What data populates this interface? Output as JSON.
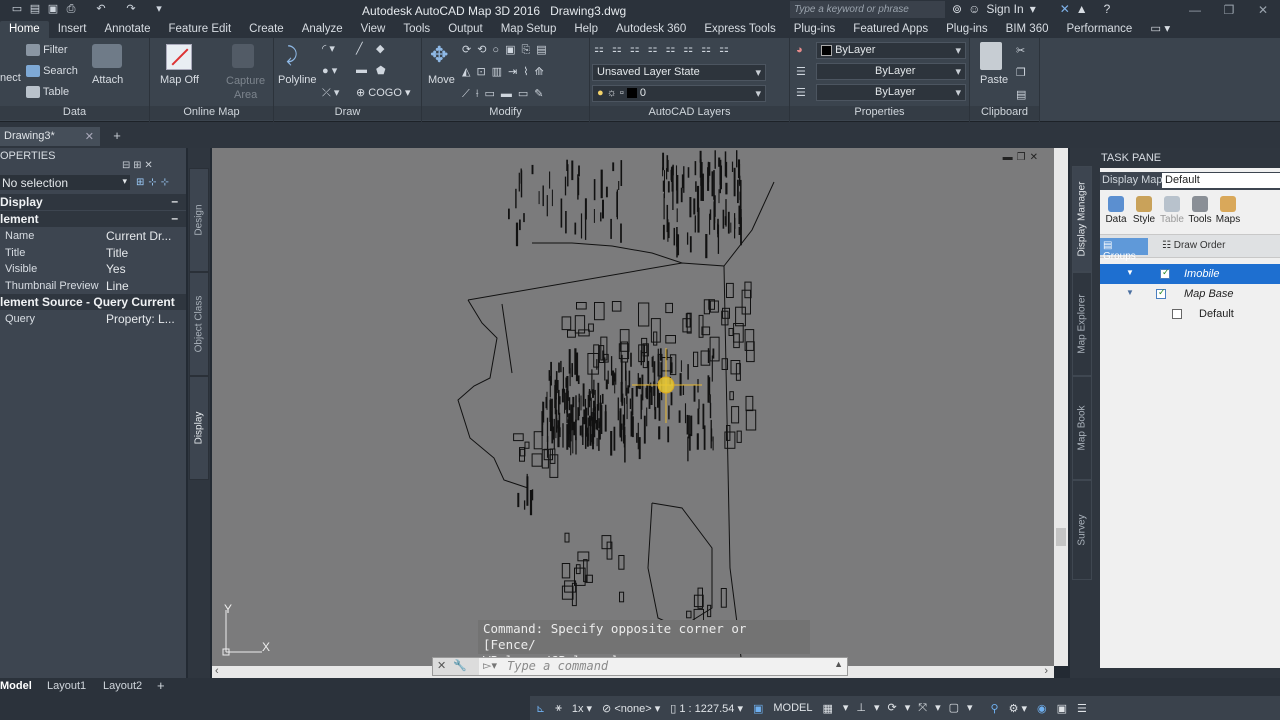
{
  "app": {
    "title": "Autodesk AutoCAD Map 3D 2016",
    "document": "Drawing3.dwg",
    "search_placeholder": "Type a keyword or phrase",
    "sign_in": "Sign In"
  },
  "ribbon_tabs": [
    "Home",
    "Insert",
    "Annotate",
    "Feature Edit",
    "Create",
    "Analyze",
    "View",
    "Tools",
    "Output",
    "Map Setup",
    "Help",
    "Autodesk 360",
    "Express Tools",
    "Plug-ins",
    "Featured Apps",
    "Plug-ins",
    "BIM 360",
    "Performance"
  ],
  "ribbon": {
    "data": {
      "filter": "Filter",
      "search": "Search",
      "table": "Table",
      "connect": "nect",
      "attach": "Attach",
      "title": "Data"
    },
    "online_map": {
      "map_off": "Map Off",
      "capture": "Capture",
      "area": "Area",
      "title": "Online Map"
    },
    "draw": {
      "polyline": "Polyline",
      "cogo": "COGO",
      "title": "Draw"
    },
    "modify": {
      "move": "Move",
      "title": "Modify"
    },
    "layers": {
      "layer_state": "Unsaved Layer State",
      "layer": "0",
      "title": "AutoCAD Layers"
    },
    "properties": {
      "color": "ByLayer",
      "linetype": "ByLayer",
      "lineweight": "ByLayer",
      "title": "Properties"
    },
    "clipboard": {
      "paste": "Paste",
      "title": "Clipboard"
    }
  },
  "doc_tab": "Drawing3*",
  "properties": {
    "title": "OPERTIES",
    "selection": "No selection",
    "section_display": "Display",
    "section_element": "lement",
    "rows": [
      {
        "k": "Name",
        "v": "Current  Dr..."
      },
      {
        "k": "Title",
        "v": "Title"
      },
      {
        "k": "Visible",
        "v": "Yes"
      },
      {
        "k": "Thumbnail Preview",
        "v": "Line"
      }
    ],
    "section_source": "lement Source - Query Current",
    "query": {
      "k": "Query",
      "v": "Property: L..."
    },
    "side_tabs": [
      "Design",
      "Object Class",
      "Display"
    ]
  },
  "command": {
    "history_1": "Command: Specify opposite corner or [Fence/",
    "history_2": "WPolygon/CPolygon]:",
    "prompt": "Type a command"
  },
  "ucs": {
    "x": "X",
    "y": "Y"
  },
  "task_pane": {
    "title": "TASK PANE",
    "display_map_label": "Display Map:",
    "display_map_value": "Default",
    "tools": [
      "Data",
      "Style",
      "Table",
      "Tools",
      "Maps"
    ],
    "groups": "Groups",
    "draw_order": "Draw Order",
    "layers": [
      {
        "name": "Imobile",
        "selected": true
      },
      {
        "name": "Map Base",
        "selected": false
      },
      {
        "name": "Default",
        "selected": false
      }
    ],
    "side_tabs": [
      "Display Manager",
      "Map Explorer",
      "Map Book",
      "Survey"
    ]
  },
  "layout_tabs": [
    "Model",
    "Layout1",
    "Layout2"
  ],
  "status": {
    "scale_factor": "1x",
    "osnap": "<none>",
    "scale": "1 : 1227.54",
    "space": "MODEL"
  },
  "colors": {
    "accent": "#1e6fd0",
    "canvas": "#7b7b7c",
    "ribbon": "#3b444e"
  }
}
